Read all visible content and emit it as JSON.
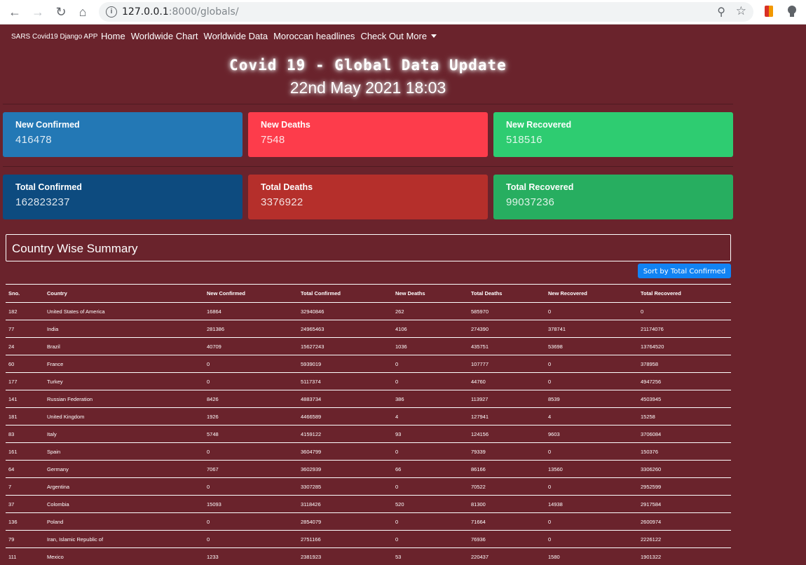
{
  "browser": {
    "url_host": "127.0.0.1",
    "url_rest": ":8000/globals/"
  },
  "nav": {
    "brand": "SARS Covid19 Django APP",
    "links": [
      "Home",
      "Worldwide Chart",
      "Worldwide Data",
      "Moroccan headlines",
      "Check Out More"
    ]
  },
  "header": {
    "title": "Covid 19 - Global Data Update",
    "datetime": "22nd May 2021 18:03"
  },
  "cards": {
    "new_confirmed": {
      "label": "New Confirmed",
      "value": "416478"
    },
    "new_deaths": {
      "label": "New Deaths",
      "value": "7548"
    },
    "new_recovered": {
      "label": "New Recovered",
      "value": "518516"
    },
    "total_confirmed": {
      "label": "Total Confirmed",
      "value": "162823237"
    },
    "total_deaths": {
      "label": "Total Deaths",
      "value": "3376922"
    },
    "total_recovered": {
      "label": "Total Recovered",
      "value": "99037236"
    }
  },
  "summary": {
    "title": "Country Wise Summary",
    "sort_button": "Sort by Total Confirmed"
  },
  "table": {
    "headers": [
      "Sno.",
      "Country",
      "New Confirmed",
      "Total Confirmed",
      "New Deaths",
      "Total Deaths",
      "New Recovered",
      "Total Recovered"
    ],
    "rows": [
      [
        "182",
        "United States of America",
        "16864",
        "32940846",
        "262",
        "585970",
        "0",
        "0"
      ],
      [
        "77",
        "India",
        "281386",
        "24965463",
        "4106",
        "274390",
        "378741",
        "21174076"
      ],
      [
        "24",
        "Brazil",
        "40709",
        "15627243",
        "1036",
        "435751",
        "53698",
        "13764520"
      ],
      [
        "60",
        "France",
        "0",
        "5939019",
        "0",
        "107777",
        "0",
        "378958"
      ],
      [
        "177",
        "Turkey",
        "0",
        "5117374",
        "0",
        "44760",
        "0",
        "4947256"
      ],
      [
        "141",
        "Russian Federation",
        "8426",
        "4883734",
        "386",
        "113927",
        "8539",
        "4503945"
      ],
      [
        "181",
        "United Kingdom",
        "1926",
        "4466589",
        "4",
        "127941",
        "4",
        "15258"
      ],
      [
        "83",
        "Italy",
        "5748",
        "4159122",
        "93",
        "124156",
        "9603",
        "3706084"
      ],
      [
        "161",
        "Spain",
        "0",
        "3604799",
        "0",
        "79339",
        "0",
        "150376"
      ],
      [
        "64",
        "Germany",
        "7067",
        "3602939",
        "66",
        "86166",
        "13560",
        "3306260"
      ],
      [
        "7",
        "Argentina",
        "0",
        "3307285",
        "0",
        "70522",
        "0",
        "2952599"
      ],
      [
        "37",
        "Colombia",
        "15093",
        "3118426",
        "520",
        "81300",
        "14938",
        "2917584"
      ],
      [
        "136",
        "Poland",
        "0",
        "2854079",
        "0",
        "71664",
        "0",
        "2600974"
      ],
      [
        "79",
        "Iran, Islamic Republic of",
        "0",
        "2751166",
        "0",
        "76936",
        "0",
        "2226122"
      ],
      [
        "111",
        "Mexico",
        "1233",
        "2381923",
        "53",
        "220437",
        "1580",
        "1901322"
      ]
    ]
  }
}
